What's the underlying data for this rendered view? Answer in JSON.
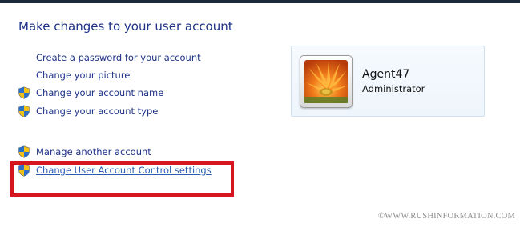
{
  "page": {
    "title": "Make changes to your user account"
  },
  "tasks": [
    {
      "label": "Create a password for your account",
      "icon": "none"
    },
    {
      "label": "Change your picture",
      "icon": "none"
    },
    {
      "label": "Change your account name",
      "icon": "uac-shield-icon"
    },
    {
      "label": "Change your account type",
      "icon": "uac-shield-icon"
    },
    {
      "label": "Manage another account",
      "icon": "uac-shield-icon"
    },
    {
      "label": "Change User Account Control settings",
      "icon": "uac-shield-icon"
    }
  ],
  "account": {
    "name": "Agent47",
    "role": "Administrator",
    "picture": "flower-picture"
  },
  "watermark": "©WWW.RUSHINFORMATION.COM",
  "colors": {
    "link": "#1e3287",
    "highlight_box": "#d6161e",
    "card_border": "#cfe0ee"
  }
}
